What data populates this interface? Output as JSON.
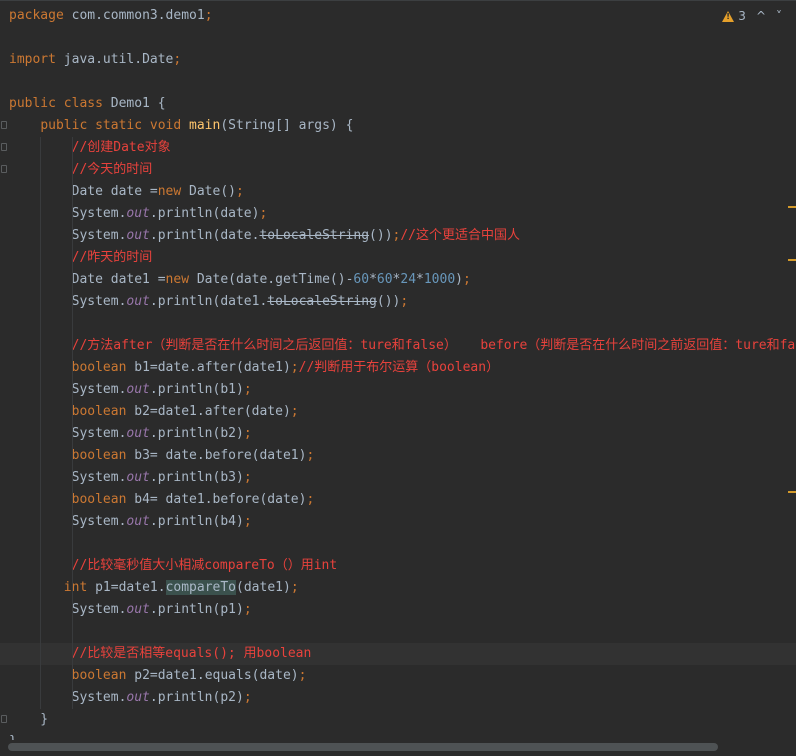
{
  "inspection": {
    "warning_count": "3",
    "prev_label": "^",
    "next_label": "˅"
  },
  "lines": [
    {
      "tokens": [
        {
          "t": "package ",
          "c": "k"
        },
        {
          "t": "com.common3.demo1"
        },
        {
          "t": ";",
          "c": "k"
        }
      ]
    },
    {
      "tokens": []
    },
    {
      "tokens": [
        {
          "t": "import ",
          "c": "k"
        },
        {
          "t": "java.util.Date"
        },
        {
          "t": ";",
          "c": "k"
        }
      ]
    },
    {
      "tokens": []
    },
    {
      "tokens": [
        {
          "t": "public class ",
          "c": "k"
        },
        {
          "t": "Demo1 {"
        }
      ]
    },
    {
      "tokens": [
        {
          "t": "    "
        },
        {
          "t": "public static void ",
          "c": "k"
        },
        {
          "t": "main",
          "c": "f"
        },
        {
          "t": "(String[] args) {"
        }
      ]
    },
    {
      "tokens": [
        {
          "t": "        "
        },
        {
          "t": "//创建Date对象",
          "c": "c"
        }
      ]
    },
    {
      "tokens": [
        {
          "t": "        "
        },
        {
          "t": "//今天的时间",
          "c": "c"
        }
      ]
    },
    {
      "tokens": [
        {
          "t": "        Date date ="
        },
        {
          "t": "new ",
          "c": "k"
        },
        {
          "t": "Date()"
        },
        {
          "t": ";",
          "c": "k"
        }
      ]
    },
    {
      "tokens": [
        {
          "t": "        System."
        },
        {
          "t": "out",
          "c": "o"
        },
        {
          "t": ".println(date)"
        },
        {
          "t": ";",
          "c": "k"
        }
      ]
    },
    {
      "tokens": [
        {
          "t": "        System."
        },
        {
          "t": "out",
          "c": "o"
        },
        {
          "t": ".println(date."
        },
        {
          "t": "toLocaleString",
          "c": "s"
        },
        {
          "t": "())"
        },
        {
          "t": ";",
          "c": "k"
        },
        {
          "t": "//这个更适合中国人",
          "c": "c"
        }
      ]
    },
    {
      "tokens": [
        {
          "t": "        "
        },
        {
          "t": "//昨天的时间",
          "c": "c"
        }
      ]
    },
    {
      "tokens": [
        {
          "t": "        Date date1 ="
        },
        {
          "t": "new ",
          "c": "k"
        },
        {
          "t": "Date(date.getTime()-"
        },
        {
          "t": "60",
          "c": "n"
        },
        {
          "t": "*"
        },
        {
          "t": "60",
          "c": "n"
        },
        {
          "t": "*"
        },
        {
          "t": "24",
          "c": "n"
        },
        {
          "t": "*"
        },
        {
          "t": "1000",
          "c": "n"
        },
        {
          "t": ")"
        },
        {
          "t": ";",
          "c": "k"
        }
      ]
    },
    {
      "tokens": [
        {
          "t": "        System."
        },
        {
          "t": "out",
          "c": "o"
        },
        {
          "t": ".println(date1."
        },
        {
          "t": "toLocaleString",
          "c": "s"
        },
        {
          "t": "())"
        },
        {
          "t": ";",
          "c": "k"
        }
      ]
    },
    {
      "tokens": []
    },
    {
      "tokens": [
        {
          "t": "        "
        },
        {
          "t": "//方法after（判断是否在什么时间之后返回值：ture和false）   before（判断是否在什么时间之前返回值：ture和false）",
          "c": "c"
        }
      ]
    },
    {
      "tokens": [
        {
          "t": "        "
        },
        {
          "t": "boolean ",
          "c": "k"
        },
        {
          "t": "b1=date.after(date1)"
        },
        {
          "t": ";",
          "c": "k"
        },
        {
          "t": "//判断用于布尔运算（boolean）",
          "c": "c"
        }
      ]
    },
    {
      "tokens": [
        {
          "t": "        System."
        },
        {
          "t": "out",
          "c": "o"
        },
        {
          "t": ".println(b1)"
        },
        {
          "t": ";",
          "c": "k"
        }
      ]
    },
    {
      "tokens": [
        {
          "t": "        "
        },
        {
          "t": "boolean ",
          "c": "k"
        },
        {
          "t": "b2=date1.after(date)"
        },
        {
          "t": ";",
          "c": "k"
        }
      ]
    },
    {
      "tokens": [
        {
          "t": "        System."
        },
        {
          "t": "out",
          "c": "o"
        },
        {
          "t": ".println(b2)"
        },
        {
          "t": ";",
          "c": "k"
        }
      ]
    },
    {
      "tokens": [
        {
          "t": "        "
        },
        {
          "t": "boolean ",
          "c": "k"
        },
        {
          "t": "b3= date.before(date1)"
        },
        {
          "t": ";",
          "c": "k"
        }
      ]
    },
    {
      "tokens": [
        {
          "t": "        System."
        },
        {
          "t": "out",
          "c": "o"
        },
        {
          "t": ".println(b3)"
        },
        {
          "t": ";",
          "c": "k"
        }
      ]
    },
    {
      "tokens": [
        {
          "t": "        "
        },
        {
          "t": "boolean ",
          "c": "k"
        },
        {
          "t": "b4= date1.before(date)"
        },
        {
          "t": ";",
          "c": "k"
        }
      ]
    },
    {
      "tokens": [
        {
          "t": "        System."
        },
        {
          "t": "out",
          "c": "o"
        },
        {
          "t": ".println(b4)"
        },
        {
          "t": ";",
          "c": "k"
        }
      ]
    },
    {
      "tokens": []
    },
    {
      "tokens": [
        {
          "t": "        "
        },
        {
          "t": "//比较毫秒值大小相减compareTo（）用int",
          "c": "c"
        }
      ]
    },
    {
      "tokens": [
        {
          "t": "       "
        },
        {
          "t": "int ",
          "c": "k"
        },
        {
          "t": "p1=date1."
        },
        {
          "t": "compareTo",
          "c": "h"
        },
        {
          "t": "(date1)"
        },
        {
          "t": ";",
          "c": "k"
        }
      ]
    },
    {
      "tokens": [
        {
          "t": "        System."
        },
        {
          "t": "out",
          "c": "o"
        },
        {
          "t": ".println(p1)"
        },
        {
          "t": ";",
          "c": "k"
        }
      ]
    },
    {
      "tokens": []
    },
    {
      "current": true,
      "tokens": [
        {
          "t": "        "
        },
        {
          "t": "//比较是否相等equals(); 用boolean",
          "c": "c"
        }
      ]
    },
    {
      "tokens": [
        {
          "t": "        "
        },
        {
          "t": "boolean ",
          "c": "k"
        },
        {
          "t": "p2=date1.equals(date)"
        },
        {
          "t": ";",
          "c": "k"
        }
      ]
    },
    {
      "tokens": [
        {
          "t": "        System."
        },
        {
          "t": "out",
          "c": "o"
        },
        {
          "t": ".println(p2)"
        },
        {
          "t": ";",
          "c": "k"
        }
      ]
    },
    {
      "tokens": [
        {
          "t": "    }"
        }
      ]
    },
    {
      "tokens": [
        {
          "t": "}"
        }
      ]
    }
  ]
}
